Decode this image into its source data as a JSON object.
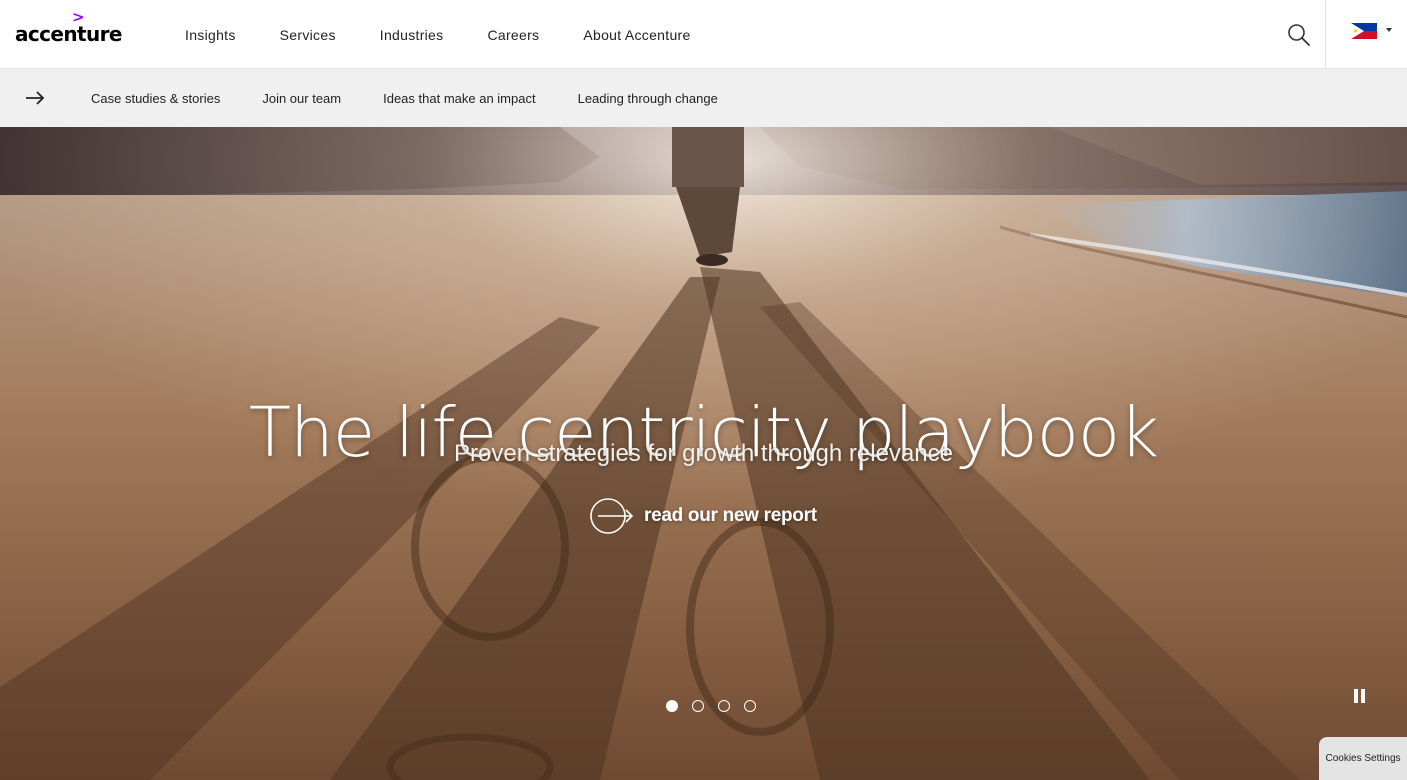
{
  "brand": {
    "name": "accenture",
    "caret": ">",
    "accent_color": "#a100ff"
  },
  "main_nav": [
    {
      "label": "Insights"
    },
    {
      "label": "Services"
    },
    {
      "label": "Industries"
    },
    {
      "label": "Careers"
    },
    {
      "label": "About Accenture"
    }
  ],
  "header": {
    "search_icon": "search-icon",
    "country_flag": "philippines-flag-icon"
  },
  "sub_nav": {
    "arrow_icon": "arrow-right-icon",
    "items": [
      {
        "label": "Case studies & stories"
      },
      {
        "label": "Join our team"
      },
      {
        "label": "Ideas that make an impact"
      },
      {
        "label": "Leading through change"
      }
    ]
  },
  "hero": {
    "title": "The life centricity playbook",
    "subtitle": "Proven strategies for growth through relevance",
    "cta_label": "read our new report",
    "cta_icon": "circle-arrow-icon",
    "slides_total": 4,
    "active_slide": 1,
    "pause_icon": "pause-icon"
  },
  "cookies": {
    "label": "Cookies Settings"
  }
}
